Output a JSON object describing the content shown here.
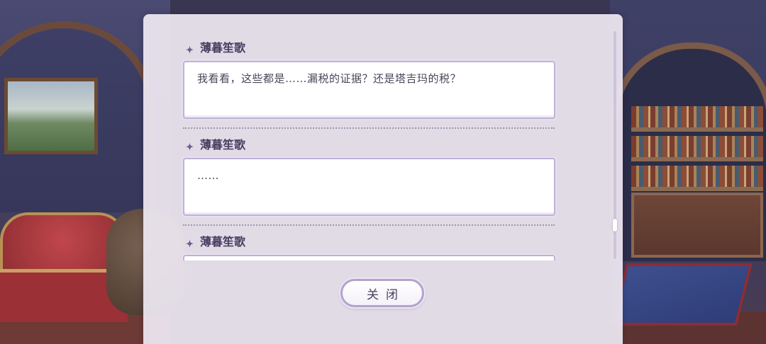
{
  "log": {
    "entries": [
      {
        "speaker": "薄暮笙歌",
        "text": "我看看，这些都是……漏税的证据？还是塔吉玛的税？"
      },
      {
        "speaker": "薄暮笙歌",
        "text": "……"
      },
      {
        "speaker": "薄暮笙歌",
        "text": ""
      }
    ]
  },
  "close_label": "关闭",
  "icons": {
    "speaker_marker": "sparkle-star-icon"
  },
  "colors": {
    "panel_bg": "#eee8f2",
    "accent_border": "#bfb1d8",
    "speaker_text": "#4a3f62"
  }
}
